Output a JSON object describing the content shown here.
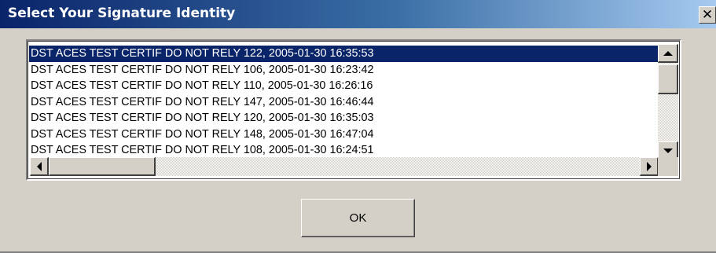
{
  "window": {
    "title": "Select Your Signature Identity",
    "close_label": "✕"
  },
  "list": {
    "items": [
      "DST ACES TEST CERTIF DO NOT RELY 122, 2005-01-30 16:35:53",
      "DST ACES TEST CERTIF DO NOT RELY 106, 2005-01-30 16:23:42",
      "DST ACES TEST CERTIF DO NOT RELY 110, 2005-01-30 16:26:16",
      "DST ACES TEST CERTIF DO NOT RELY 147, 2005-01-30 16:46:44",
      "DST ACES TEST CERTIF DO NOT RELY 120, 2005-01-30 16:35:03",
      "DST ACES TEST CERTIF DO NOT RELY 148, 2005-01-30 16:47:04",
      "DST ACES TEST CERTIF DO NOT RELY 108, 2005-01-30 16:24:51"
    ],
    "selected_index": 0
  },
  "buttons": {
    "ok_label": "OK"
  },
  "icons": {
    "close": "close-icon",
    "scroll_up": "arrow-up-icon",
    "scroll_down": "arrow-down-icon",
    "scroll_left": "arrow-left-icon",
    "scroll_right": "arrow-right-icon"
  },
  "colors": {
    "title_gradient_start": "#0a246a",
    "title_gradient_end": "#a6caf0",
    "selection": "#0a246a",
    "face": "#d4d0c8"
  }
}
